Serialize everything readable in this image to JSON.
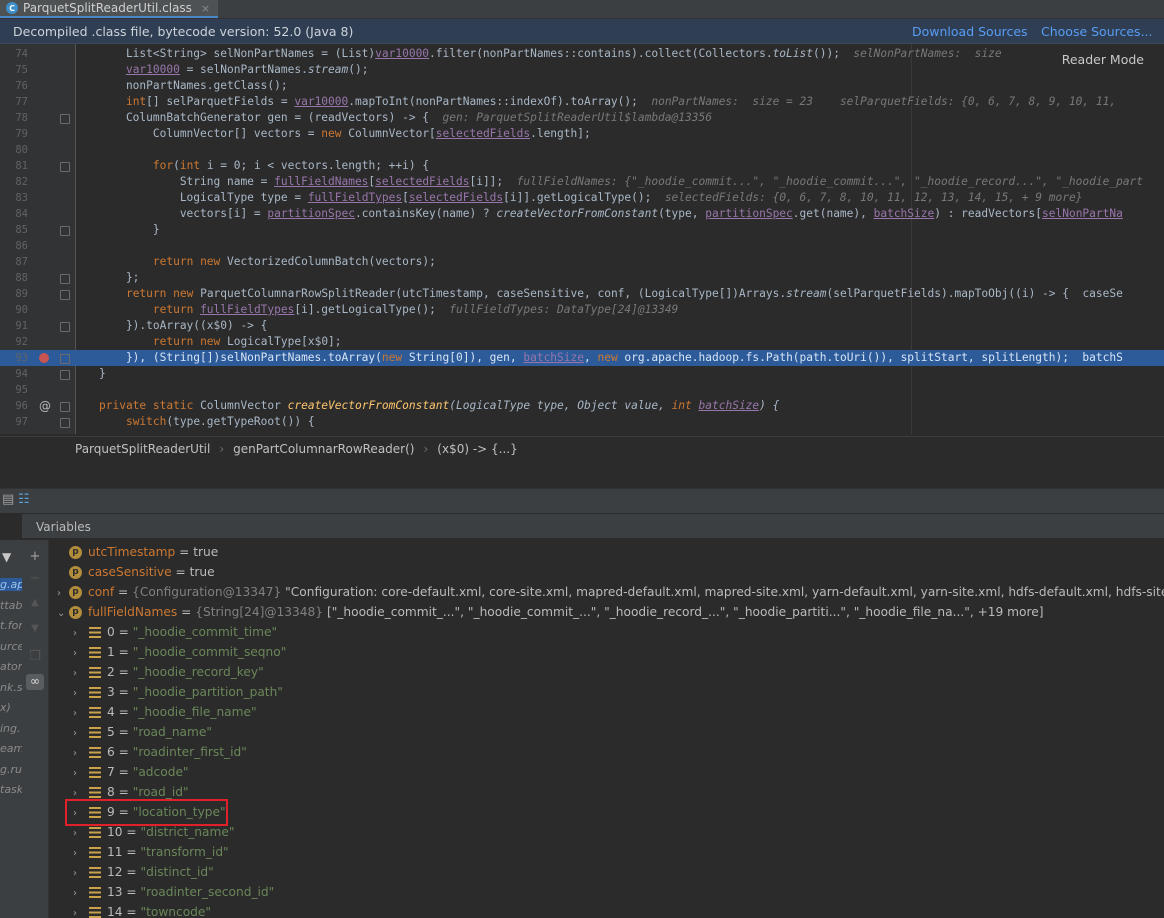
{
  "tab": {
    "title": "ParquetSplitReaderUtil.class",
    "close": "×"
  },
  "banner": {
    "text": "Decompiled .class file, bytecode version: 52.0 (Java 8)",
    "download_sources": "Download Sources",
    "choose_sources": "Choose Sources..."
  },
  "editor": {
    "reader_mode": "Reader Mode",
    "lines": [
      {
        "n": "74",
        "text": "    List<String> selNonPartNames = (List)var10000.filter(nonPartNames::contains).collect(Collectors.toList());  selNonPartNames:  size"
      },
      {
        "n": "75",
        "text": "    var10000 = selNonPartNames.stream();"
      },
      {
        "n": "76",
        "text": "    nonPartNames.getClass();"
      },
      {
        "n": "77",
        "text": "    int[] selParquetFields = var10000.mapToInt(nonPartNames::indexOf).toArray();  nonPartNames:  size = 23    selParquetFields: {0, 6, 7, 8, 9, 10, 11,"
      },
      {
        "n": "78",
        "text": "    ColumnBatchGenerator gen = (readVectors) -> {  gen: ParquetSplitReaderUtil$lambda@13356"
      },
      {
        "n": "79",
        "text": "        ColumnVector[] vectors = new ColumnVector[selectedFields.length];"
      },
      {
        "n": "80",
        "text": ""
      },
      {
        "n": "81",
        "text": "        for(int i = 0; i < vectors.length; ++i) {"
      },
      {
        "n": "82",
        "text": "            String name = fullFieldNames[selectedFields[i]];  fullFieldNames: {\"_hoodie_commit...\", \"_hoodie_commit...\", \"_hoodie_record...\", \"_hoodie_part"
      },
      {
        "n": "83",
        "text": "            LogicalType type = fullFieldTypes[selectedFields[i]].getLogicalType();  selectedFields: {0, 6, 7, 8, 10, 11, 12, 13, 14, 15, + 9 more}"
      },
      {
        "n": "84",
        "text": "            vectors[i] = partitionSpec.containsKey(name) ? createVectorFromConstant(type, partitionSpec.get(name), batchSize) : readVectors[selNonPartNa"
      },
      {
        "n": "85",
        "text": "        }"
      },
      {
        "n": "86",
        "text": ""
      },
      {
        "n": "87",
        "text": "        return new VectorizedColumnBatch(vectors);"
      },
      {
        "n": "88",
        "text": "    };"
      },
      {
        "n": "89",
        "text": "    return new ParquetColumnarRowSplitReader(utcTimestamp, caseSensitive, conf, (LogicalType[])Arrays.stream(selParquetFields).mapToObj((i) -> {  caseSe"
      },
      {
        "n": "90",
        "text": "        return fullFieldTypes[i].getLogicalType();  fullFieldTypes: DataType[24]@13349"
      },
      {
        "n": "91",
        "text": "    }).toArray((x$0) -> {"
      },
      {
        "n": "92",
        "text": "        return new LogicalType[x$0];"
      },
      {
        "n": "93",
        "text": "    }), (String[])selNonPartNames.toArray(new String[0]), gen, batchSize, new org.apache.hadoop.fs.Path(path.toUri()), splitStart, splitLength);  batchS"
      },
      {
        "n": "94",
        "text": "}"
      },
      {
        "n": "95",
        "text": ""
      },
      {
        "n": "96",
        "text": "private static ColumnVector createVectorFromConstant(LogicalType type, Object value, int batchSize) {"
      },
      {
        "n": "97",
        "text": "    switch(type.getTypeRoot()) {"
      }
    ]
  },
  "breadcrumb": [
    "ParquetSplitReaderUtil",
    "genPartColumnarRowReader()",
    "(x$0) -> {...}"
  ],
  "variables_title": "Variables",
  "left_fragments": [
    "g.ap",
    "ttab",
    "t.for",
    "urce",
    "ator",
    "nk.s",
    "x)",
    "ing.",
    "eam",
    "g.ru",
    "task"
  ],
  "vars": [
    {
      "name": "utcTimestamp",
      "value": "true",
      "expand": false,
      "kind": "p"
    },
    {
      "name": "caseSensitive",
      "value": "true",
      "expand": false,
      "kind": "p"
    },
    {
      "name": "conf",
      "type": "{Configuration@13347}",
      "value": "\"Configuration: core-default.xml, core-site.xml, mapred-default.xml, mapred-site.xml, yarn-default.xml, yarn-site.xml, hdfs-default.xml, hdfs-site.xml, D:/dev",
      "expand": true,
      "kind": "p"
    },
    {
      "name": "fullFieldNames",
      "type": "{String[24]@13348}",
      "value": "[\"_hoodie_commit_...\", \"_hoodie_commit_...\", \"_hoodie_record_...\", \"_hoodie_partiti...\", \"_hoodie_file_na...\", +19 more]",
      "expand": true,
      "kind": "p",
      "open": true
    }
  ],
  "items": [
    {
      "idx": "0",
      "val": "\"_hoodie_commit_time\""
    },
    {
      "idx": "1",
      "val": "\"_hoodie_commit_seqno\""
    },
    {
      "idx": "2",
      "val": "\"_hoodie_record_key\""
    },
    {
      "idx": "3",
      "val": "\"_hoodie_partition_path\""
    },
    {
      "idx": "4",
      "val": "\"_hoodie_file_name\""
    },
    {
      "idx": "5",
      "val": "\"road_name\""
    },
    {
      "idx": "6",
      "val": "\"roadinter_first_id\""
    },
    {
      "idx": "7",
      "val": "\"adcode\""
    },
    {
      "idx": "8",
      "val": "\"road_id\""
    },
    {
      "idx": "9",
      "val": "\"location_type\""
    },
    {
      "idx": "10",
      "val": "\"district_name\""
    },
    {
      "idx": "11",
      "val": "\"transform_id\""
    },
    {
      "idx": "12",
      "val": "\"distinct_id\""
    },
    {
      "idx": "13",
      "val": "\"roadinter_second_id\""
    },
    {
      "idx": "14",
      "val": "\"towncode\""
    }
  ],
  "colors": {
    "accent": "#4a88c7",
    "highlight": "#2d5b9a",
    "breakpoint": "#c75450",
    "redbox": "#e0212a"
  }
}
